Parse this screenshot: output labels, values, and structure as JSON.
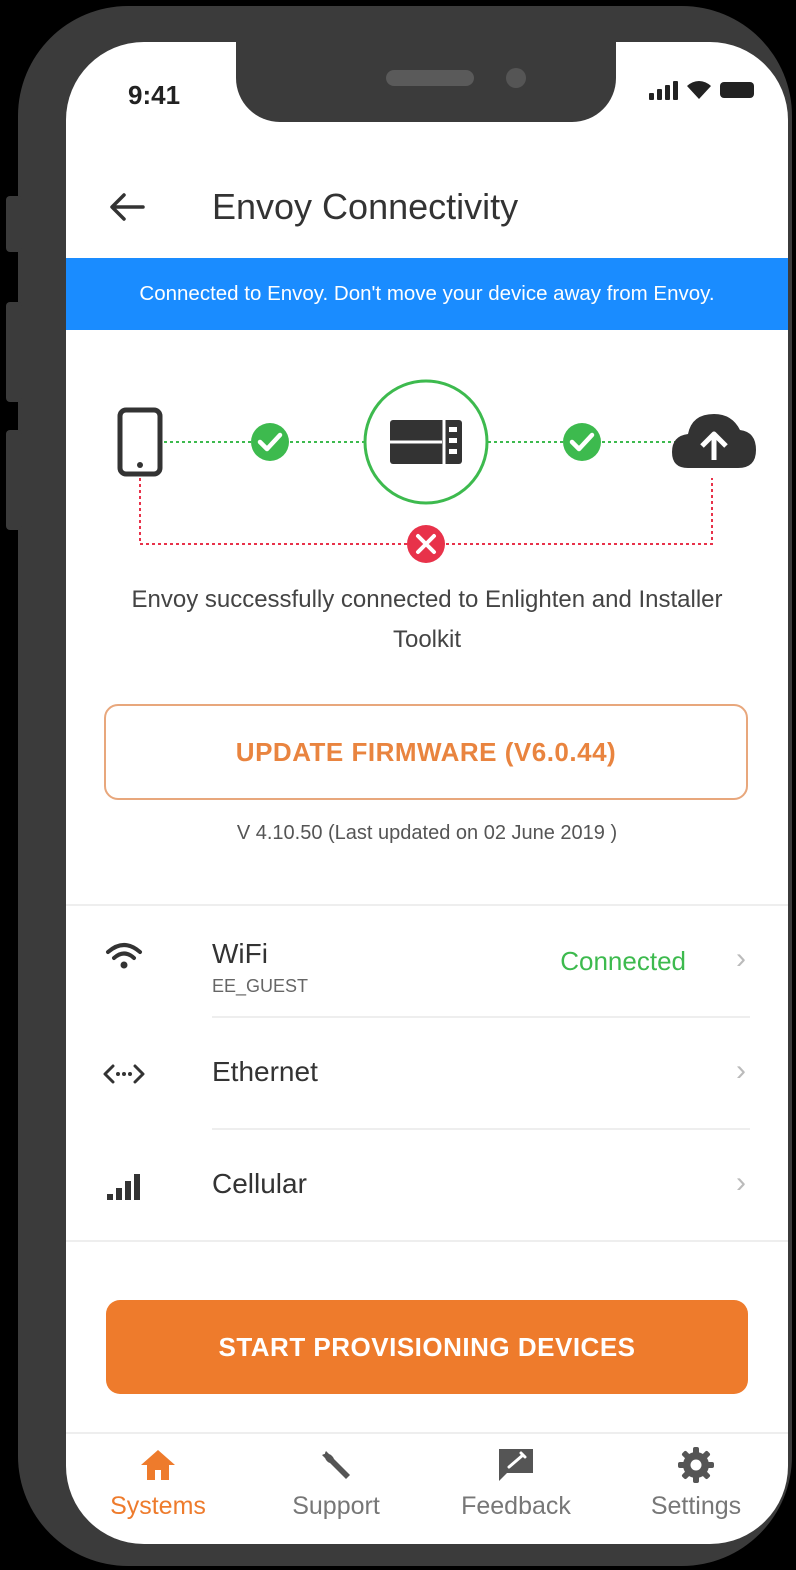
{
  "status_bar": {
    "time": "9:41"
  },
  "header": {
    "title": "Envoy Connectivity"
  },
  "banner": {
    "text": "Connected to Envoy. Don't move your device away from Envoy."
  },
  "diagram": {
    "message": "Envoy successfully connected to Enlighten and Installer Toolkit"
  },
  "firmware": {
    "button_label": "UPDATE FIRMWARE (V6.0.44)",
    "version_text": "V 4.10.50 (Last updated on 02 June 2019 )"
  },
  "connections": [
    {
      "name": "WiFi",
      "subtitle": "EE_GUEST",
      "status": "Connected"
    },
    {
      "name": "Ethernet"
    },
    {
      "name": "Cellular"
    }
  ],
  "provision_button": {
    "label": "START PROVISIONING DEVICES"
  },
  "tabs": [
    {
      "label": "Systems",
      "active": true
    },
    {
      "label": "Support"
    },
    {
      "label": "Feedback"
    },
    {
      "label": "Settings"
    }
  ],
  "colors": {
    "banner": "#1a8cff",
    "accent_orange": "#ee7b2c",
    "success_green": "#3dba4e",
    "error_red": "#e8324a"
  },
  "icons": {
    "back": "arrow-left-icon",
    "phone": "smartphone-icon",
    "envoy": "envoy-device-icon",
    "cloud": "cloud-upload-icon",
    "check": "check-circle-icon",
    "error": "x-circle-icon",
    "wifi": "wifi-icon",
    "ethernet": "ethernet-icon",
    "cellular": "cellular-signal-icon",
    "systems": "home-icon",
    "support": "wrench-icon",
    "feedback": "feedback-icon",
    "settings": "gear-icon"
  }
}
